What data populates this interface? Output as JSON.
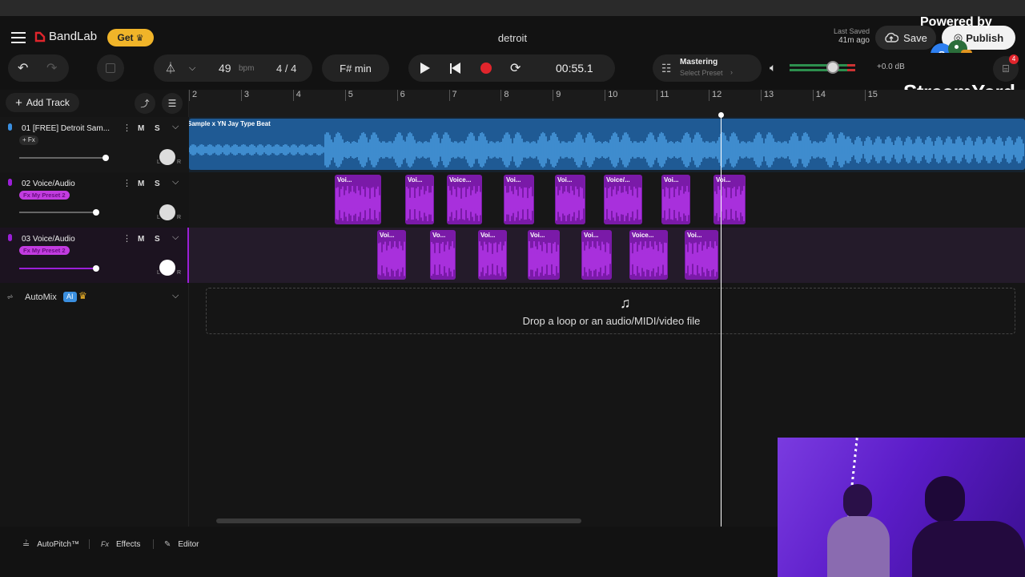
{
  "header": {
    "brand": "BandLab",
    "get_label": "Get",
    "project_title": "detroit",
    "last_saved_label": "Last Saved",
    "last_saved_time": "41m ago",
    "save_label": "Save",
    "publish_label": "Publish",
    "overlay_powered": "Powered by",
    "overlay_brand": "StreamYard",
    "notif_count": "4"
  },
  "toolbar": {
    "bpm_value": "49",
    "bpm_unit": "bpm",
    "time_signature": "4 / 4",
    "key": "F# min",
    "timecode": "00:55.1",
    "mastering_label": "Mastering",
    "mastering_preset": "Select Preset",
    "master_db": "+0.0 dB",
    "master_level": 0.55
  },
  "sidebar": {
    "add_track_label": "Add Track",
    "automix_label": "AutoMix",
    "automix_ai_badge": "AI"
  },
  "ruler": {
    "bars": [
      "2",
      "3",
      "4",
      "5",
      "6",
      "7",
      "8",
      "9",
      "10",
      "11",
      "12",
      "13",
      "14",
      "15"
    ]
  },
  "tracks": [
    {
      "name": "01  [FREE] Detroit Sam...",
      "fx": "+ Fx",
      "volume": 0.92,
      "mute": "M",
      "solo": "S",
      "pan_l": "L",
      "pan_r": "R",
      "clip_label": "Sample x YN Jay Type Beat"
    },
    {
      "name": "02  Voice/Audio",
      "fx": "Fx  My Preset 2",
      "volume": 0.84,
      "mute": "M",
      "solo": "S",
      "pan_l": "L",
      "pan_r": "R",
      "clips": [
        "Voi...",
        "Voi...",
        "Voice...",
        "Voi...",
        "Voi...",
        "Voice/...",
        "Voi...",
        "Voi..."
      ]
    },
    {
      "name": "03  Voice/Audio",
      "fx": "Fx  My Preset 2",
      "volume": 0.84,
      "mute": "M",
      "solo": "S",
      "pan_l": "L",
      "pan_r": "R",
      "clips": [
        "Voi...",
        "Vo...",
        "Voi...",
        "Voi...",
        "Voi...",
        "Voice...",
        "Voi..."
      ]
    }
  ],
  "dropzone": {
    "text": "Drop a loop or an audio/MIDI/video file"
  },
  "bottom": {
    "autopitch": "AutoPitch™",
    "effects": "Effects",
    "editor": "Editor",
    "fx_prefix": "Fx"
  },
  "colors": {
    "accent_blue": "#3a8fe0",
    "accent_purple": "#9b1fd8",
    "get_badge": "#f0b429",
    "record_red": "#e0252c"
  }
}
